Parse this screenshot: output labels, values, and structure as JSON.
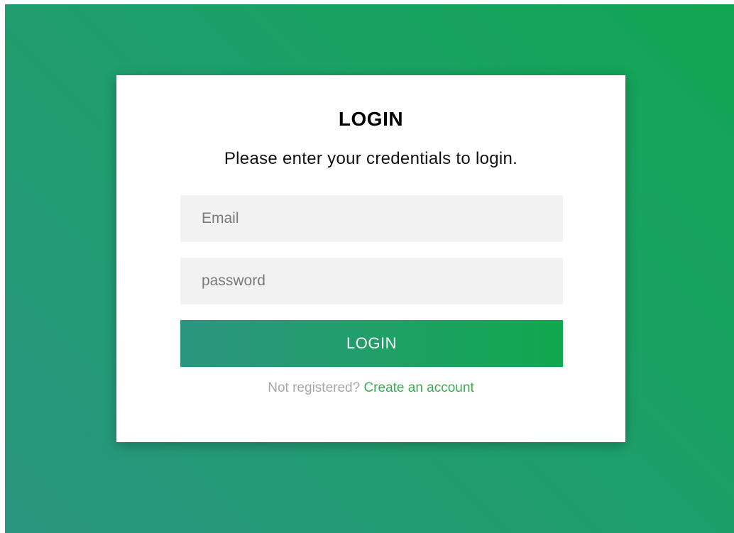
{
  "colors": {
    "background_start": "#2a9680",
    "background_end": "#12a552",
    "card": "#ffffff",
    "input_background": "#f2f2f2",
    "link": "#3caa4f"
  },
  "login": {
    "title": "LOGIN",
    "subtitle": "Please enter your credentials to login.",
    "email_placeholder": "Email",
    "password_placeholder": "password",
    "button_label": "LOGIN",
    "footer_text": "Not registered?",
    "signup_link": "Create an account"
  }
}
